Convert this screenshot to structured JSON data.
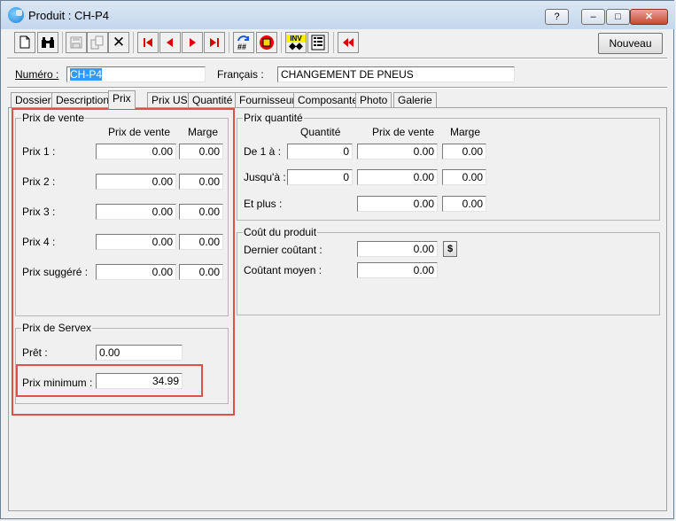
{
  "window": {
    "title": "Produit : CH-P4",
    "help_label": "?",
    "minimize_label": "‒",
    "maximize_label": "□",
    "close_label": "✕"
  },
  "toolbar": {
    "nouveau_label": "Nouveau",
    "icons": [
      "new-document-icon",
      "find-binoculars-icon",
      "save-icon",
      "copy-icon",
      "delete-icon",
      "first-record-icon",
      "previous-record-icon",
      "next-record-icon",
      "last-record-icon",
      "renumber-icon",
      "stop-icon",
      "inventory-icon",
      "list-icon",
      "rewind-icon"
    ],
    "inv_text": "INV"
  },
  "header": {
    "numero_label": "Numéro :",
    "numero_value": "CH-P4",
    "francais_label": "Français :",
    "francais_value": "CHANGEMENT DE PNEUS"
  },
  "tabs": [
    {
      "label": "Dossier"
    },
    {
      "label": "Description"
    },
    {
      "label": "Prix"
    },
    {
      "label": "Prix US"
    },
    {
      "label": "Quantité"
    },
    {
      "label": "Fournisseur"
    },
    {
      "label": "Composante"
    },
    {
      "label": "Photo"
    },
    {
      "label": "Galerie"
    }
  ],
  "prix_de_vente": {
    "title": "Prix de vente",
    "col_prix": "Prix de vente",
    "col_marge": "Marge",
    "rows": [
      {
        "label": "Prix 1 :",
        "prix": "0.00",
        "marge": "0.00"
      },
      {
        "label": "Prix 2 :",
        "prix": "0.00",
        "marge": "0.00"
      },
      {
        "label": "Prix 3 :",
        "prix": "0.00",
        "marge": "0.00"
      },
      {
        "label": "Prix 4 :",
        "prix": "0.00",
        "marge": "0.00"
      },
      {
        "label": "Prix suggéré :",
        "prix": "0.00",
        "marge": "0.00"
      }
    ]
  },
  "prix_servex": {
    "title": "Prix de Servex",
    "pret_label": "Prêt :",
    "pret_value": "0.00",
    "prix_min_label": "Prix minimum :",
    "prix_min_value": "34.99"
  },
  "prix_quantite": {
    "title": "Prix quantité",
    "col_qte": "Quantité",
    "col_prix": "Prix de vente",
    "col_marge": "Marge",
    "rows": [
      {
        "label": "De 1 à :",
        "qte": "0",
        "prix": "0.00",
        "marge": "0.00"
      },
      {
        "label": "Jusqu'à :",
        "qte": "0",
        "prix": "0.00",
        "marge": "0.00"
      },
      {
        "label": "Et plus :",
        "prix": "0.00",
        "marge": "0.00"
      }
    ]
  },
  "cout": {
    "title": "Coût du produit",
    "dernier_label": "Dernier coûtant :",
    "dernier_value": "0.00",
    "dollar_label": "$",
    "moyen_label": "Coûtant moyen :",
    "moyen_value": "0.00"
  },
  "colors": {
    "highlight": "#e0504a",
    "selection": "#3399ff"
  }
}
